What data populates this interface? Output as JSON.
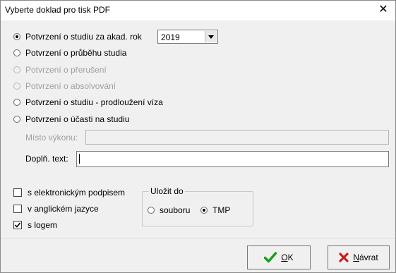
{
  "window": {
    "title": "Vyberte doklad pro tisk PDF",
    "close_glyph": "✕"
  },
  "document_options": [
    {
      "label": "Potvrzení o studiu za akad. rok",
      "checked": true,
      "enabled": true
    },
    {
      "label": "Potvrzení o průběhu studia",
      "checked": false,
      "enabled": true
    },
    {
      "label": "Potvrzení o přerušení",
      "checked": false,
      "enabled": false
    },
    {
      "label": "Potvrzení o absolvování",
      "checked": false,
      "enabled": false
    },
    {
      "label": "Potvrzení o studiu - prodloužení víza",
      "checked": false,
      "enabled": true
    },
    {
      "label": "Potvrzení o účasti na studiu",
      "checked": false,
      "enabled": true
    }
  ],
  "year_select": {
    "value": "2019"
  },
  "misto_vykonu": {
    "label": "Místo výkonu:",
    "value": "",
    "enabled": false
  },
  "dopln_text": {
    "label": "Doplň. text:",
    "value": ""
  },
  "checkboxes": [
    {
      "label": "s elektronickým podpisem",
      "checked": false
    },
    {
      "label": "v anglickém jazyce",
      "checked": false
    },
    {
      "label": "s logem",
      "checked": true
    }
  ],
  "save_group": {
    "title": "Uložit do",
    "options": [
      {
        "label": "souboru",
        "checked": false
      },
      {
        "label": "TMP",
        "checked": true
      }
    ]
  },
  "buttons": {
    "ok": {
      "label_underlined": "O",
      "label_rest": "K",
      "icon": "check-icon",
      "icon_color": "#1a9e1a"
    },
    "back": {
      "label_underlined": "N",
      "label_rest": "ávrat",
      "icon": "x-icon",
      "icon_color": "#c81e1e"
    }
  }
}
